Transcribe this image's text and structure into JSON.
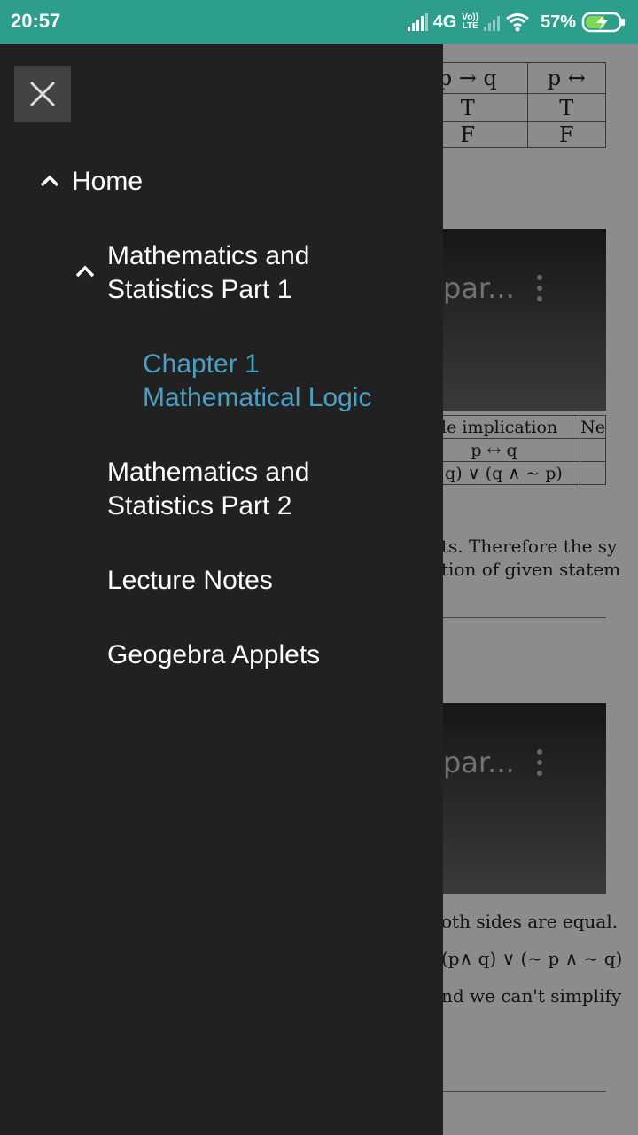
{
  "status_bar": {
    "time": "20:57",
    "network": "4G",
    "lte_top": "Vo))",
    "lte_bottom": "LTE",
    "battery": "57%"
  },
  "drawer": {
    "items": [
      {
        "label": "Home"
      },
      {
        "label_line1": "Mathematics and",
        "label_line2": "Statistics Part 1"
      },
      {
        "label_line1": "Chapter 1",
        "label_line2": "Mathematical Logic"
      },
      {
        "label_line1": "Mathematics and",
        "label_line2": "Statistics Part 2"
      },
      {
        "label": "Lecture Notes"
      },
      {
        "label": "Geogebra Applets"
      }
    ]
  },
  "background": {
    "table1": {
      "h1": "p → q",
      "h2": "p ↔",
      "r1": "T",
      "r2": "T",
      "r3": "F",
      "r4": "F"
    },
    "video_title": "par...",
    "table2": {
      "h1": "ble implication",
      "h2": "Ne",
      "r1": "p ↔ q",
      "r2": "~ q) ∨ (q ∧ ~ p)"
    },
    "para1_line1": "ts. Therefore the sy",
    "para1_line2": "tion of given statem",
    "para2_line1": "oth sides are equal.",
    "para2_line2": "(p∧ q) ∨ (~ p ∧ ~ q)",
    "para2_line3": "nd we can't simplify"
  }
}
